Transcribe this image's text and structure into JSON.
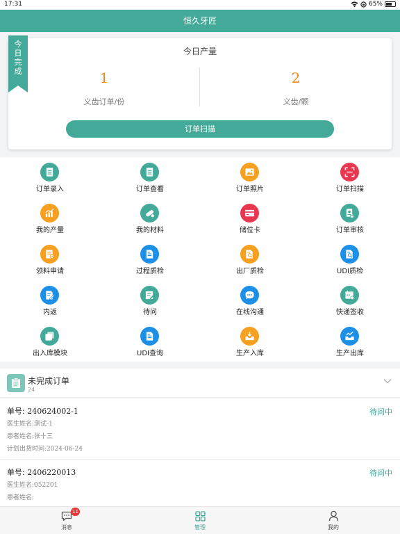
{
  "status_bar": {
    "time": "17:31",
    "battery": "65%",
    "battery_level": 0.65
  },
  "header": {
    "title": "恒久牙匠"
  },
  "today": {
    "ribbon": [
      "今",
      "日",
      "完",
      "成"
    ],
    "title": "今日产量",
    "stats": [
      {
        "value": "1",
        "label": "义齿订单/份"
      },
      {
        "value": "2",
        "label": "义齿/颗"
      }
    ],
    "scan_button": "订单扫描"
  },
  "menu": [
    {
      "label": "订单录入",
      "color": "#43aa99",
      "icon": "doc-list-icon"
    },
    {
      "label": "订单查看",
      "color": "#43aa99",
      "icon": "doc-list-icon"
    },
    {
      "label": "订单照片",
      "color": "#f5a020",
      "icon": "image-icon"
    },
    {
      "label": "订单扫描",
      "color": "#e83850",
      "icon": "scan-icon"
    },
    {
      "label": "我的产量",
      "color": "#f5a020",
      "icon": "chart-icon"
    },
    {
      "label": "我的材料",
      "color": "#43aa99",
      "icon": "pill-icon"
    },
    {
      "label": "储位卡",
      "color": "#e83850",
      "icon": "card-icon"
    },
    {
      "label": "订单审核",
      "color": "#43aa99",
      "icon": "audit-icon"
    },
    {
      "label": "领料申请",
      "color": "#f5a020",
      "icon": "apply-icon"
    },
    {
      "label": "过程质检",
      "color": "#1e8fe6",
      "icon": "doc-icon"
    },
    {
      "label": "出厂质检",
      "color": "#f5a020",
      "icon": "doc-search-icon"
    },
    {
      "label": "UDI质检",
      "color": "#1e8fe6",
      "icon": "doc-search-icon"
    },
    {
      "label": "内返",
      "color": "#1e8fe6",
      "icon": "edit-icon"
    },
    {
      "label": "待问",
      "color": "#43aa99",
      "icon": "edit-doc-icon"
    },
    {
      "label": "在线沟通",
      "color": "#1e8fe6",
      "icon": "chat-icon"
    },
    {
      "label": "快递签收",
      "color": "#43aa99",
      "icon": "calendar-icon"
    },
    {
      "label": "出入库模块",
      "color": "#43aa99",
      "icon": "copy-icon"
    },
    {
      "label": "UDI查询",
      "color": "#1e8fe6",
      "icon": "doc-icon"
    },
    {
      "label": "生产入库",
      "color": "#f5a020",
      "icon": "inbox-in-icon"
    },
    {
      "label": "生产出库",
      "color": "#1e8fe6",
      "icon": "inbox-out-icon"
    }
  ],
  "orders": {
    "title": "未完成订单",
    "count": "24",
    "items": [
      {
        "no_label": "单号:",
        "no": "240624002-1",
        "status": "待问中",
        "doctor": "医生姓名:测试-1",
        "patient": "患者姓名:张十三",
        "ship": "计划出货时间:2024-06-24"
      },
      {
        "no_label": "单号:",
        "no": "2406220013",
        "status": "待问中",
        "doctor": "医生姓名:052201",
        "patient": "患者姓名:"
      }
    ]
  },
  "tabbar": {
    "messages": "消息",
    "messages_badge": "11",
    "manage": "管理",
    "mine": "我的"
  }
}
